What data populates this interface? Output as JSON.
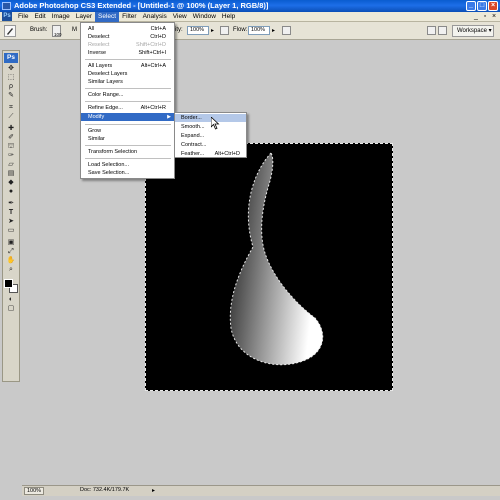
{
  "window": {
    "title": "Adobe Photoshop CS3 Extended - [Untitled-1 @ 100% (Layer 1, RGB/8)]",
    "buttons": {
      "minimize": "_",
      "maximize": "□",
      "close": "×"
    }
  },
  "menubar": {
    "logo": "Ps",
    "items": [
      "File",
      "Edit",
      "Image",
      "Layer",
      "Select",
      "Filter",
      "Analysis",
      "View",
      "Window",
      "Help"
    ],
    "active": "Select"
  },
  "options_bar": {
    "brush_label": "Brush:",
    "brush_size": "100",
    "mode_label": "M",
    "opacity_partial": "ity:",
    "opacity_value": "100%",
    "flow_label": "Flow:",
    "flow_value": "100%",
    "workspace_label": "Workspace ▾"
  },
  "select_menu": {
    "items": [
      {
        "label": "All",
        "shortcut": "Ctrl+A",
        "disabled": false
      },
      {
        "label": "Deselect",
        "shortcut": "Ctrl+D",
        "disabled": false
      },
      {
        "label": "Reselect",
        "shortcut": "Shift+Ctrl+D",
        "disabled": true
      },
      {
        "label": "Inverse",
        "shortcut": "Shift+Ctrl+I",
        "disabled": false
      },
      {
        "label": "All Layers",
        "shortcut": "Alt+Ctrl+A",
        "disabled": false
      },
      {
        "label": "Deselect Layers",
        "shortcut": "",
        "disabled": false
      },
      {
        "label": "Similar Layers",
        "shortcut": "",
        "disabled": false
      },
      {
        "label": "Color Range...",
        "shortcut": "",
        "disabled": false
      },
      {
        "label": "Refine Edge...",
        "shortcut": "Alt+Ctrl+R",
        "disabled": false
      },
      {
        "label": "Modify",
        "shortcut": "",
        "disabled": false,
        "highlighted": true
      },
      {
        "label": "Grow",
        "shortcut": "",
        "disabled": false
      },
      {
        "label": "Similar",
        "shortcut": "",
        "disabled": false
      },
      {
        "label": "Transform Selection",
        "shortcut": "",
        "disabled": false
      },
      {
        "label": "Load Selection...",
        "shortcut": "",
        "disabled": false
      },
      {
        "label": "Save Selection...",
        "shortcut": "",
        "disabled": false
      }
    ]
  },
  "modify_submenu": {
    "items": [
      {
        "label": "Border...",
        "shortcut": "",
        "highlighted": true
      },
      {
        "label": "Smooth...",
        "shortcut": ""
      },
      {
        "label": "Expand...",
        "shortcut": ""
      },
      {
        "label": "Contract...",
        "shortcut": ""
      },
      {
        "label": "Feather...",
        "shortcut": "Alt+Ctrl+D"
      }
    ]
  },
  "toolbox": {
    "badge": "Ps",
    "tools": [
      "move-tool",
      "marquee-tool",
      "lasso-tool",
      "quick-selection-tool",
      "crop-tool",
      "slice-tool",
      "healing-tool",
      "brush-tool",
      "clone-stamp-tool",
      "history-brush-tool",
      "eraser-tool",
      "gradient-tool",
      "blur-tool",
      "dodge-tool",
      "pen-tool",
      "type-tool",
      "path-selection-tool",
      "shape-tool",
      "notes-tool",
      "eyedropper-tool",
      "hand-tool",
      "zoom-tool"
    ],
    "foreground_color": "#000000",
    "background_color": "#ffffff"
  },
  "document": {
    "canvas_color": "#000000",
    "shape_gradient": [
      "#1a1a1a",
      "#ffffff"
    ]
  },
  "statusbar": {
    "zoom": "100%",
    "doc_info": "Doc: 732.4K/179.7K"
  }
}
